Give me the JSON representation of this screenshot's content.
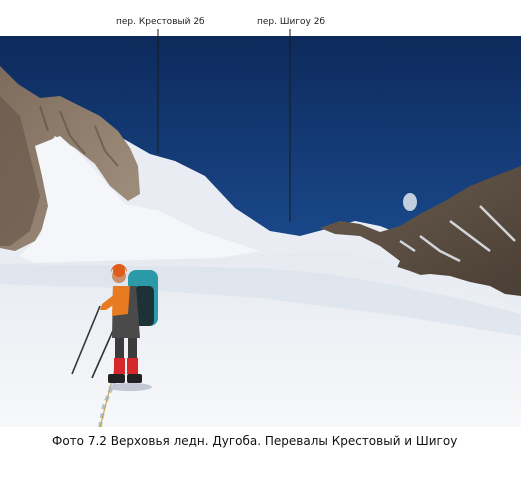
{
  "labels": {
    "pass_krestovy": "пер. Крестовый 2б",
    "pass_shigou": "пер. Шигоу 2б"
  },
  "caption": "Фото 7.2 Верховья ледн. Дугоба. Перевалы Крестовый и Шигоу",
  "colors": {
    "sky_top": "#0d2a5c",
    "sky_bottom": "#1f57a8",
    "snow": "#f2f4f7",
    "snow_shadow": "#d9dfe8",
    "rock": "#8a7866",
    "rock_dark": "#5a4c40",
    "pointer_line": "#1a1a1a"
  }
}
